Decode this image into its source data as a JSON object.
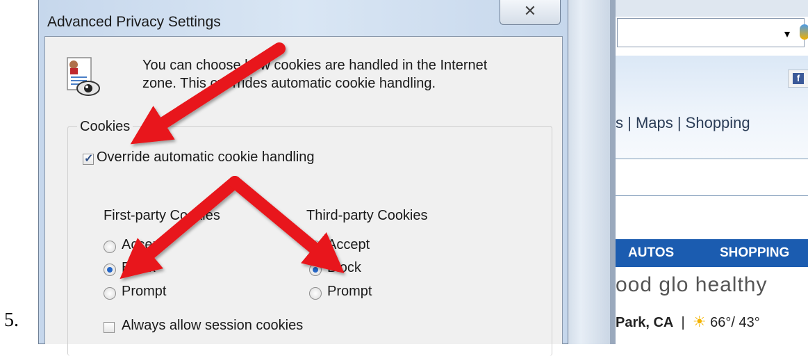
{
  "step_number": "5.",
  "dialog": {
    "title": "Advanced Privacy Settings",
    "close_label": "✕",
    "info_line1": "You can choose how cookies are handled in the Internet",
    "info_line2": "zone.  This overrides automatic cookie handling.",
    "icon": "privacy-document-eye-icon",
    "cookies_group": {
      "label": "Cookies",
      "override_label": "Override automatic cookie handling",
      "override_checked": true,
      "first_party": {
        "heading": "First-party Cookies",
        "options": [
          "Accept",
          "Block",
          "Prompt"
        ],
        "selected": "Block"
      },
      "third_party": {
        "heading": "Third-party Cookies",
        "options": [
          "Accept",
          "Block",
          "Prompt"
        ],
        "selected": "Block"
      },
      "session_label": "Always allow session cookies",
      "session_checked": false
    }
  },
  "browser": {
    "address_dropdown": "▾",
    "facebook_icon": "f",
    "nav_links": "s | Maps | Shopping",
    "category_autos": "AUTOS",
    "category_shopping": "SHOPPING",
    "headline": "ood   glo   healthy",
    "weather_location": "Park, CA",
    "weather_temps": "66°/ 43°",
    "weather_icon": "sun-cloud-icon"
  },
  "annotation_color": "#e8191a"
}
